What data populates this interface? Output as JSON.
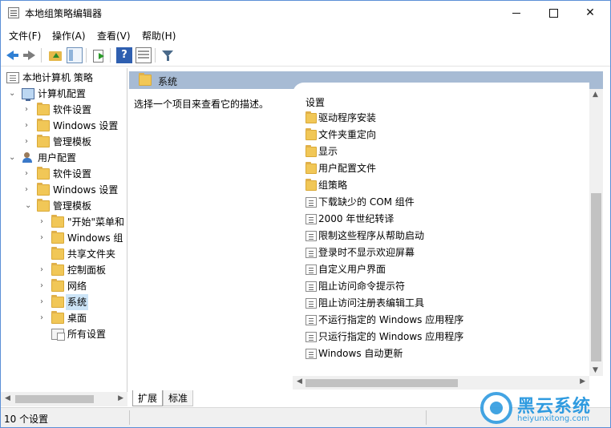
{
  "window": {
    "title": "本地组策略编辑器",
    "minimize_icon": "minimize-icon",
    "maximize_icon": "maximize-icon",
    "close_glyph": "✕"
  },
  "menu": {
    "items": [
      "文件(F)",
      "操作(A)",
      "查看(V)",
      "帮助(H)"
    ]
  },
  "toolbar": {
    "icons": [
      "back-arrow-icon",
      "forward-arrow-icon",
      "up-folder-icon",
      "show-hide-tree-icon",
      "export-list-icon",
      "help-icon",
      "properties-icon",
      "filter-icon"
    ],
    "help_glyph": "?"
  },
  "tree": {
    "chev_open": "⌄",
    "chev_closed": "›",
    "root": "本地计算机 策略",
    "computer_config": "计算机配置",
    "cc_software": "软件设置",
    "cc_windows": "Windows 设置",
    "cc_admin": "管理模板",
    "user_config": "用户配置",
    "uc_software": "软件设置",
    "uc_windows": "Windows 设置",
    "uc_admin": "管理模板",
    "start_menu": "\"开始\"菜单和",
    "windows_components": "Windows 组",
    "shared_folders": "共享文件夹",
    "control_panel": "控制面板",
    "network": "网络",
    "system": "系统",
    "desktop": "桌面",
    "all_settings": "所有设置"
  },
  "right": {
    "header": "系统",
    "description": "选择一个项目来查看它的描述。",
    "list_header": "设置",
    "folders": [
      "驱动程序安装",
      "文件夹重定向",
      "显示",
      "用户配置文件",
      "组策略"
    ],
    "settings": [
      "下载缺少的 COM 组件",
      "2000 年世纪转译",
      "限制这些程序从帮助启动",
      "登录时不显示欢迎屏幕",
      "自定义用户界面",
      "阻止访问命令提示符",
      "阻止访问注册表编辑工具",
      "不运行指定的 Windows 应用程序",
      "只运行指定的 Windows 应用程序",
      "Windows 自动更新"
    ]
  },
  "scroll": {
    "up": "▲",
    "down": "▼",
    "left": "◀",
    "right": "▶"
  },
  "tabs": {
    "extended": "扩展",
    "standard": "标准"
  },
  "status": {
    "text": "10 个设置"
  },
  "watermark": {
    "name": "黑云系统",
    "url": "heiyunxitong.com"
  },
  "colors": {
    "accent": "#2f9be0",
    "header_bar": "#a7bbd4",
    "selection": "#cce4f7"
  }
}
